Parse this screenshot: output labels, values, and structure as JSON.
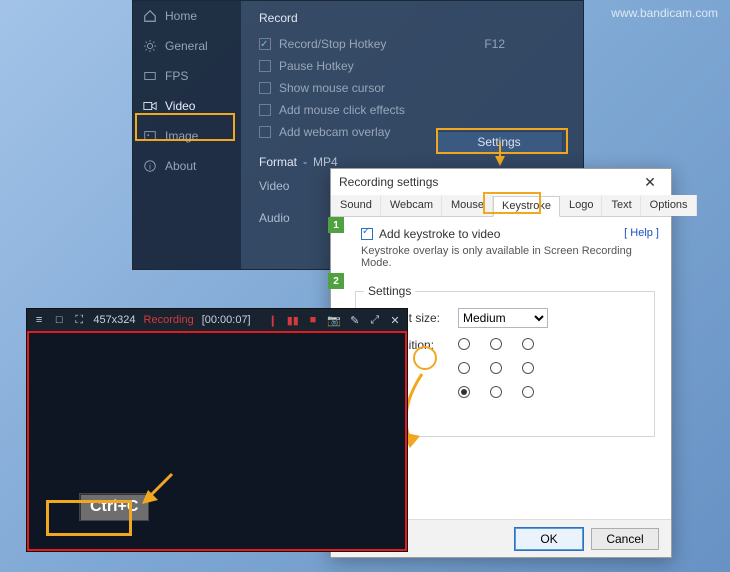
{
  "watermark": "www.bandicam.com",
  "sidebar": {
    "items": [
      {
        "label": "Home"
      },
      {
        "label": "General"
      },
      {
        "label": "FPS"
      },
      {
        "label": "Video"
      },
      {
        "label": "Image"
      },
      {
        "label": "About"
      }
    ]
  },
  "record": {
    "section_title": "Record",
    "hotkey_label": "Record/Stop Hotkey",
    "hotkey_value": "F12",
    "pause_label": "Pause Hotkey",
    "cursor_label": "Show mouse cursor",
    "click_label": "Add mouse click effects",
    "webcam_label": "Add webcam overlay",
    "settings_btn": "Settings"
  },
  "format": {
    "label": "Format",
    "value": "MP4",
    "video_label": "Video",
    "audio_label": "Audio"
  },
  "dialog": {
    "title": "Recording settings",
    "close": "✕",
    "tabs": [
      "Sound",
      "Webcam",
      "Mouse",
      "Keystroke",
      "Logo",
      "Text",
      "Options"
    ],
    "badge1": "1",
    "badge2": "2",
    "checkbox_label": "Add keystroke to video",
    "help": "[ Help ]",
    "note": "Keystroke overlay is only available in Screen Recording Mode.",
    "legend": "Settings",
    "fontsize_label": "Font size:",
    "fontsize_value": "Medium",
    "position_label": "Position:",
    "ok": "OK",
    "cancel": "Cancel"
  },
  "recording": {
    "size": "457x324",
    "status": "Recording",
    "time": "[00:00:07]",
    "keystroke": "Ctrl+C"
  }
}
